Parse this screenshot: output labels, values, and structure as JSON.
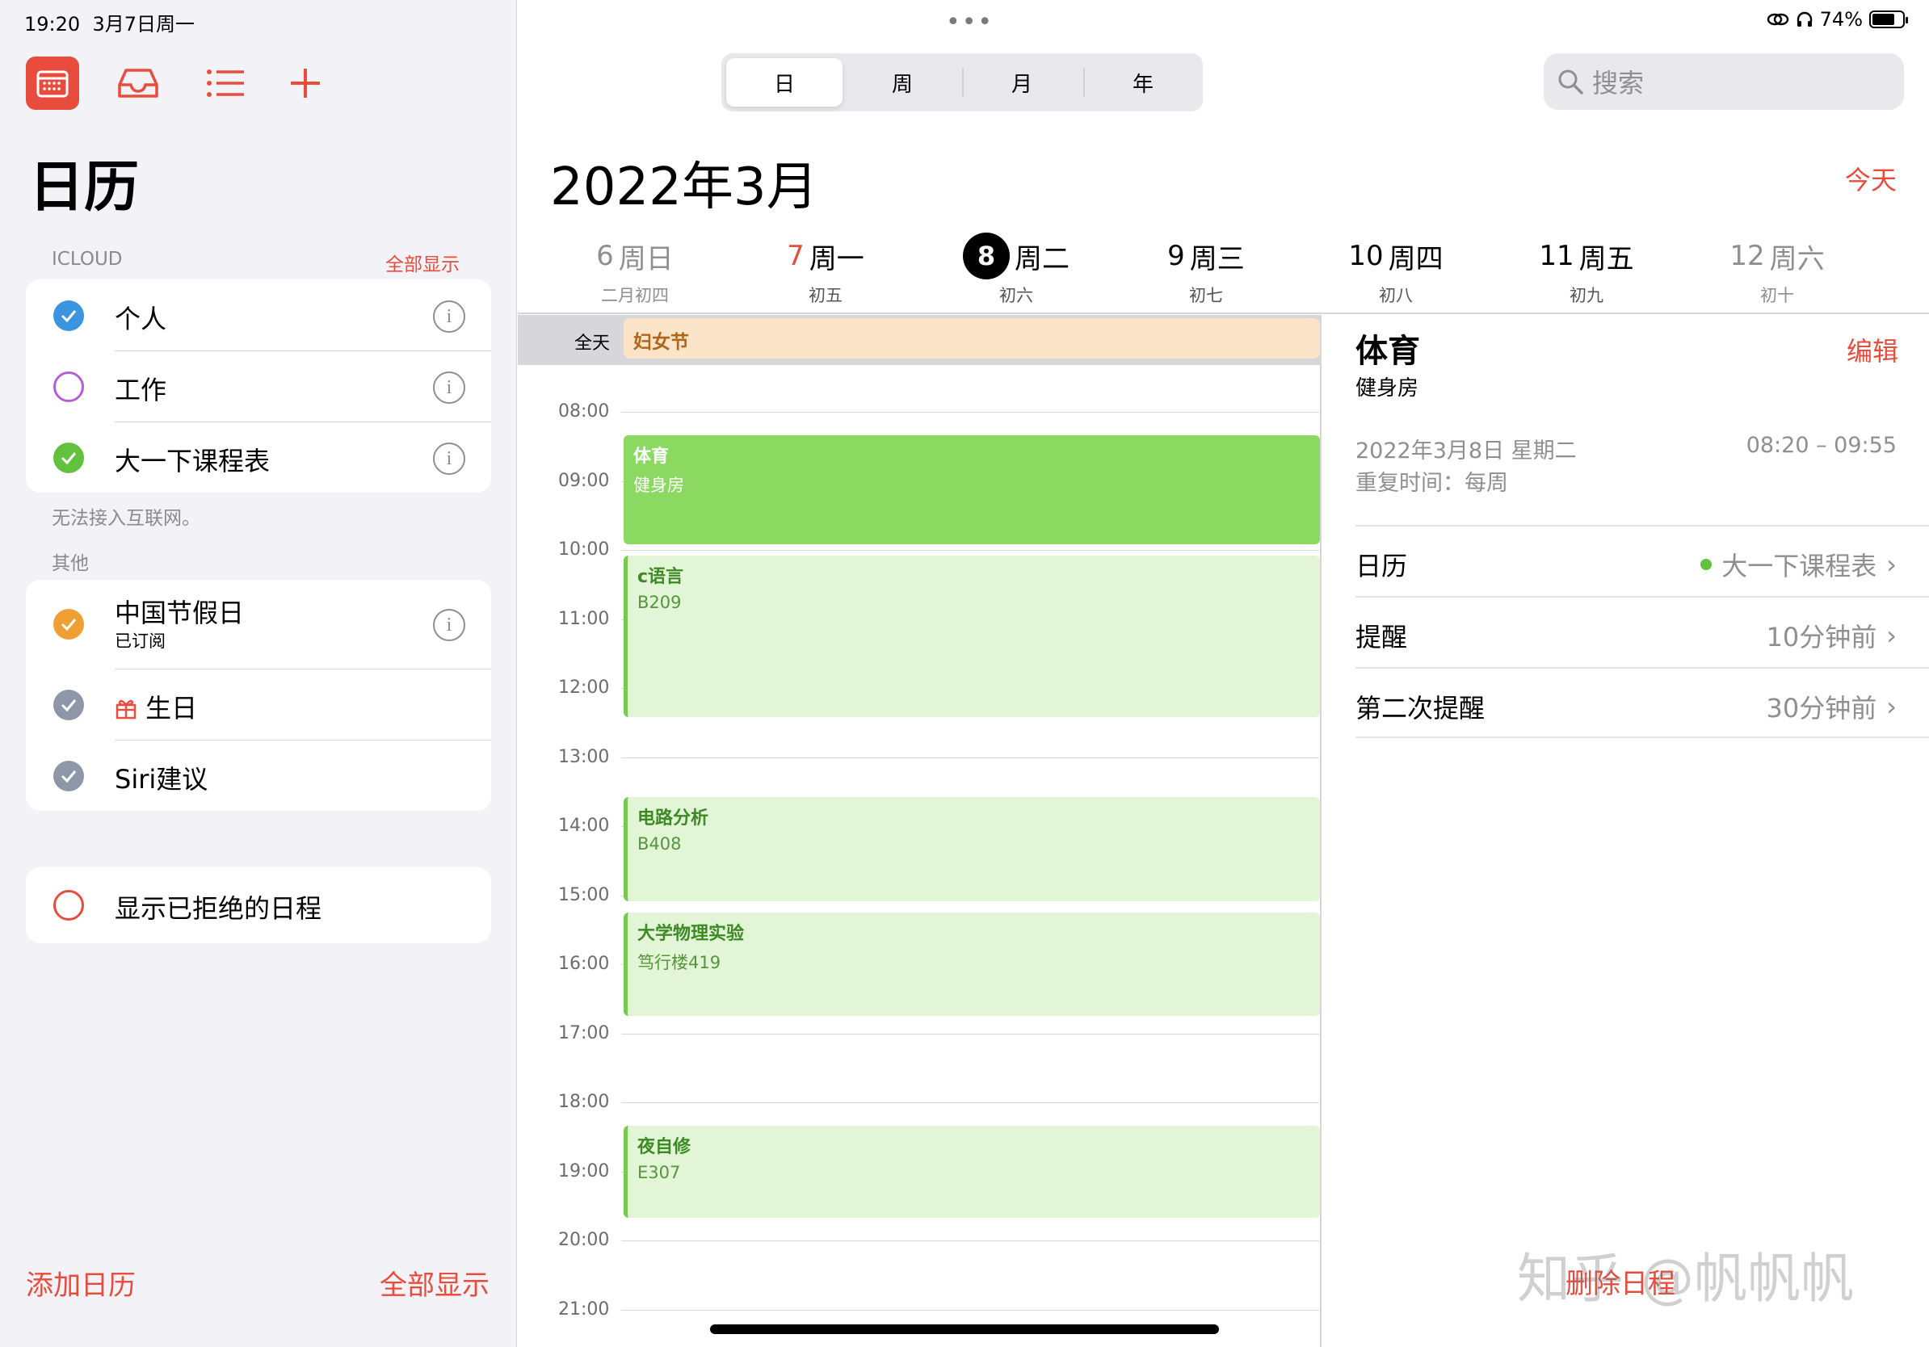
{
  "status": {
    "time": "19:20",
    "date": "3月7日周一",
    "battery": "74%",
    "battery_level": 0.74
  },
  "sidebar": {
    "title": "日历",
    "icloud_label": "ICLOUD",
    "icloud_show_all": "全部显示",
    "icloud_items": [
      {
        "label": "个人",
        "color": "#3a94e0",
        "checked": true
      },
      {
        "label": "工作",
        "color": "#b65ed6",
        "checked": false
      },
      {
        "label": "大一下课程表",
        "color": "#62c23e",
        "checked": true
      }
    ],
    "offline_note": "无法接入互联网。",
    "other_label": "其他",
    "other_items": [
      {
        "label": "中国节假日",
        "sublabel": "已订阅",
        "color": "#f0a032",
        "checked": true
      },
      {
        "label": "生日",
        "color": "#8e97a8",
        "checked": true,
        "icon": "gift-icon"
      },
      {
        "label": "Siri建议",
        "color": "#8e97a8",
        "checked": true
      }
    ],
    "declined_label": "显示已拒绝的日程",
    "add_calendar": "添加日历",
    "show_all": "全部显示"
  },
  "toolbar": {
    "segments": [
      "日",
      "周",
      "月",
      "年"
    ],
    "active_segment": "日",
    "search_placeholder": "搜索"
  },
  "header": {
    "month_title": "2022年3月",
    "today_label": "今天",
    "days": [
      {
        "num": "6",
        "name": "周日",
        "lunar": "二月初四",
        "weekend": true
      },
      {
        "num": "7",
        "name": "周一",
        "lunar": "初五",
        "red": true
      },
      {
        "num": "8",
        "name": "周二",
        "lunar": "初六",
        "selected": true
      },
      {
        "num": "9",
        "name": "周三",
        "lunar": "初七"
      },
      {
        "num": "10",
        "name": "周四",
        "lunar": "初八"
      },
      {
        "num": "11",
        "name": "周五",
        "lunar": "初九"
      },
      {
        "num": "12",
        "name": "周六",
        "lunar": "初十",
        "weekend": true
      }
    ]
  },
  "timeline": {
    "allday_label": "全天",
    "allday_event": "妇女节",
    "hours": [
      "08:00",
      "09:00",
      "10:00",
      "11:00",
      "12:00",
      "13:00",
      "14:00",
      "15:00",
      "16:00",
      "17:00",
      "18:00",
      "19:00",
      "20:00",
      "21:00"
    ],
    "events": [
      {
        "title": "体育",
        "location": "健身房",
        "start": "08:20",
        "end": "09:55",
        "selected": true
      },
      {
        "title": "c语言",
        "location": "B209",
        "start": "10:05",
        "end": "12:25"
      },
      {
        "title": "电路分析",
        "location": "B408",
        "start": "13:35",
        "end": "15:05"
      },
      {
        "title": "大学物理实验",
        "location": "笃行楼419",
        "start": "15:15",
        "end": "16:45"
      },
      {
        "title": "夜自修",
        "location": "E307",
        "start": "18:20",
        "end": "19:40"
      }
    ]
  },
  "detail": {
    "title": "体育",
    "edit_label": "编辑",
    "location": "健身房",
    "date": "2022年3月8日 星期二",
    "time": "08:20 – 09:55",
    "repeat": "重复时间：每周",
    "rows": [
      {
        "key": "日历",
        "value": "大一下课程表",
        "dot": true
      },
      {
        "key": "提醒",
        "value": "10分钟前"
      },
      {
        "key": "第二次提醒",
        "value": "30分钟前"
      }
    ],
    "delete_label": "删除日程",
    "watermark": "知乎 @帆帆帆"
  }
}
